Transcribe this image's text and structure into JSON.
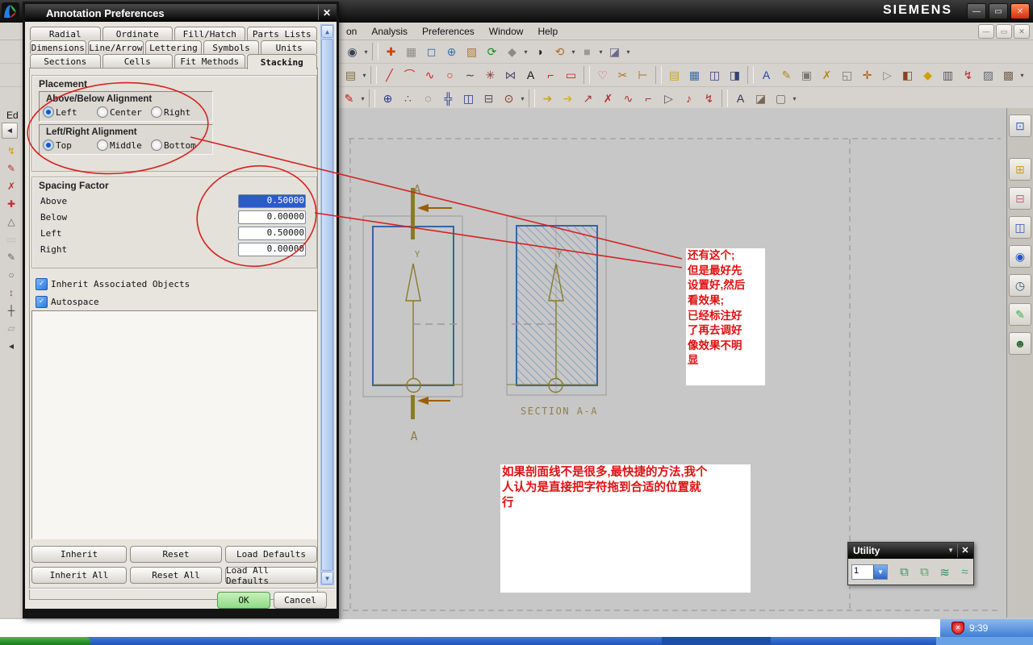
{
  "window": {
    "brand": "SIEMENS",
    "controls": {
      "minimize": "—",
      "restore": "▭",
      "close": "✕"
    }
  },
  "menu": {
    "items": [
      {
        "label": "on"
      },
      {
        "label": "Analysis"
      },
      {
        "label": "Preferences"
      },
      {
        "label": "Window"
      },
      {
        "label": "Help"
      }
    ]
  },
  "toolbars": {
    "row1": [
      {
        "n": "find",
        "g": "◉",
        "c": "#33424f",
        "d": true
      },
      {
        "n": "fit-view",
        "g": "✚",
        "c": "#cc4400",
        "s": true
      },
      {
        "n": "zoom-box",
        "g": "▦",
        "c": "#8a8a8a"
      },
      {
        "n": "zoom-region",
        "g": "◻",
        "c": "#3a6ea5"
      },
      {
        "n": "zoom-in-out",
        "g": "⊕",
        "c": "#3a6ea5"
      },
      {
        "n": "pan",
        "g": "▨",
        "c": "#b07c2a"
      },
      {
        "n": "refresh",
        "g": "⟳",
        "c": "#1f8a1f"
      },
      {
        "n": "shaded-view",
        "g": "◆",
        "c": "#8a8a8a",
        "d": true
      },
      {
        "n": "render-style",
        "g": "◑",
        "c": "#222"
      },
      {
        "n": "rotate-view",
        "g": "⟲",
        "c": "#b06a1a",
        "d": true
      },
      {
        "n": "display-mode",
        "g": "■",
        "c": "#9a9a9a",
        "d": true
      },
      {
        "n": "clip-section",
        "g": "◪",
        "c": "#6a6a8a",
        "d": true
      }
    ],
    "row2": [
      {
        "n": "note-style",
        "g": "▤",
        "c": "#7a6a3a",
        "d": true
      },
      {
        "n": "line",
        "g": "╱",
        "c": "#cc2222",
        "s": true
      },
      {
        "n": "arc",
        "g": "⌒",
        "c": "#cc2222"
      },
      {
        "n": "studio-spline",
        "g": "∿",
        "c": "#cc2222"
      },
      {
        "n": "circle",
        "g": "○",
        "c": "#cc2222"
      },
      {
        "n": "spline",
        "g": "∼",
        "c": "#444"
      },
      {
        "n": "point-curve",
        "g": "✳",
        "c": "#883333"
      },
      {
        "n": "mirror-curve",
        "g": "⋈",
        "c": "#555577"
      },
      {
        "n": "text",
        "g": "A",
        "c": "#111"
      },
      {
        "n": "corner",
        "g": "⌐",
        "c": "#cc2222"
      },
      {
        "n": "rectangle",
        "g": "▭",
        "c": "#cc2222"
      },
      {
        "n": "project-curve",
        "g": "♡",
        "c": "#cc5588",
        "s": true
      },
      {
        "n": "trim",
        "g": "✂",
        "c": "#b07020"
      },
      {
        "n": "extend",
        "g": "⊢",
        "c": "#b07020"
      },
      {
        "n": "notebooks",
        "g": "▤",
        "c": "#c9a227",
        "s": true
      },
      {
        "n": "image",
        "g": "▦",
        "c": "#3a6ea5"
      },
      {
        "n": "view-doc",
        "g": "◫",
        "c": "#334477"
      },
      {
        "n": "sheet-doc",
        "g": "◨",
        "c": "#334477"
      },
      {
        "n": "annotation-text",
        "g": "A",
        "c": "#2244aa",
        "s": true
      },
      {
        "n": "edit-text",
        "g": "✎",
        "c": "#b08a20"
      },
      {
        "n": "frame-select",
        "g": "▣",
        "c": "#777"
      },
      {
        "n": "wrench-note",
        "g": "✗",
        "c": "#b08a20"
      },
      {
        "n": "copy-view",
        "g": "◱",
        "c": "#777"
      },
      {
        "n": "datum-axis",
        "g": "✛",
        "c": "#aa5500"
      },
      {
        "n": "datum-plane",
        "g": "▷",
        "c": "#888"
      },
      {
        "n": "cube-view",
        "g": "◧",
        "c": "#884422"
      },
      {
        "n": "part-cube",
        "g": "◆",
        "c": "#d0a000"
      },
      {
        "n": "note-panel",
        "g": "▥",
        "c": "#556"
      },
      {
        "n": "move-note",
        "g": "↯",
        "c": "#a33"
      },
      {
        "n": "hatch-box",
        "g": "▨",
        "c": "#667"
      },
      {
        "n": "photo",
        "g": "▩",
        "c": "#765",
        "d": true
      }
    ],
    "row3": [
      {
        "n": "fill-style",
        "g": "✎",
        "c": "#cc1111",
        "d": true
      },
      {
        "n": "point",
        "g": "⊕",
        "c": "#223a8a",
        "s": true
      },
      {
        "n": "point-set",
        "g": "∴",
        "c": "#883355"
      },
      {
        "n": "reference-circle",
        "g": "◌",
        "c": "#445"
      },
      {
        "n": "crosshatch",
        "g": "╬",
        "c": "#223a8a"
      },
      {
        "n": "centerline-box",
        "g": "◫",
        "c": "#223a8a"
      },
      {
        "n": "centerline-2d",
        "g": "⊟",
        "c": "#556"
      },
      {
        "n": "target-point",
        "g": "⊙",
        "c": "#883322",
        "d": true
      },
      {
        "n": "key-note",
        "g": "➔",
        "c": "#c9a227",
        "s": true
      },
      {
        "n": "key-label",
        "g": "➔",
        "c": "#d4b030"
      },
      {
        "n": "leader",
        "g": "↗",
        "c": "#a33"
      },
      {
        "n": "cross-mark",
        "g": "✗",
        "c": "#a33"
      },
      {
        "n": "s-curve",
        "g": "∿",
        "c": "#a33"
      },
      {
        "n": "corner-note",
        "g": "⌐",
        "c": "#a33"
      },
      {
        "n": "flag-note",
        "g": "▷",
        "c": "#556"
      },
      {
        "n": "music-note",
        "g": "♪",
        "c": "#a33"
      },
      {
        "n": "lightning-note",
        "g": "↯",
        "c": "#a33"
      },
      {
        "n": "angular-note",
        "g": "A",
        "c": "#334",
        "s": true
      },
      {
        "n": "cube-note",
        "g": "◪",
        "c": "#765"
      },
      {
        "n": "monitor",
        "g": "▢",
        "c": "#667",
        "d": true
      }
    ]
  },
  "left_strip": {
    "label": "Ed",
    "collapse": "◄",
    "icons": [
      {
        "n": "lightning",
        "g": "↯",
        "c": "#c9a000"
      },
      {
        "n": "pencil-red",
        "g": "✎",
        "c": "#bb3333"
      },
      {
        "n": "cross-red",
        "g": "✗",
        "c": "#bb3333"
      },
      {
        "n": "plus-red",
        "g": "✚",
        "c": "#bb3333"
      },
      {
        "n": "triangle",
        "g": "△",
        "c": "#666"
      },
      {
        "n": "blank-box",
        "g": "▭",
        "c": "#bbb"
      },
      {
        "n": "pencil-grey",
        "g": "✎",
        "c": "#666"
      },
      {
        "n": "circle",
        "g": "○",
        "c": "#666"
      },
      {
        "n": "arrows",
        "g": "↕",
        "c": "#a33"
      },
      {
        "n": "cross-hair",
        "g": "┼",
        "c": "#333"
      },
      {
        "n": "parallelogram",
        "g": "▱",
        "c": "#999"
      },
      {
        "n": "collapse-arrow",
        "g": "◂",
        "c": "#333"
      }
    ]
  },
  "resource_bar": {
    "top_icon": {
      "n": "fit-window",
      "g": "⊡",
      "c": "#3366cc"
    },
    "icons": [
      {
        "n": "assembly-navigator",
        "g": "⊞",
        "c": "#c9a227"
      },
      {
        "n": "constraint-navigator",
        "g": "⊟",
        "c": "#cc6688"
      },
      {
        "n": "part-navigator",
        "g": "◫",
        "c": "#3355bb"
      },
      {
        "n": "reuse-library",
        "g": "◉",
        "c": "#2255cc"
      },
      {
        "n": "history",
        "g": "◷",
        "c": "#335577"
      },
      {
        "n": "visualization",
        "g": "✎",
        "c": "#33aa44"
      },
      {
        "n": "roles",
        "g": "☻",
        "c": "#336633"
      }
    ]
  },
  "dialog": {
    "title": "Annotation Preferences",
    "close_glyph": "✕",
    "tabs": {
      "row1": [
        "Radial",
        "Ordinate",
        "Fill/Hatch",
        "Parts Lists"
      ],
      "row2": [
        "Dimensions",
        "Line/Arrow",
        "Lettering",
        "Symbols",
        "Units"
      ],
      "row3": [
        "Sections",
        "Cells",
        "Fit Methods",
        "Stacking"
      ],
      "active": "Stacking"
    },
    "placement": {
      "header": "Placement",
      "above_below": {
        "header": "Above/Below Alignment",
        "options": [
          "Left",
          "Center",
          "Right"
        ],
        "selected": "Left"
      },
      "left_right": {
        "header": "Left/Right Alignment",
        "options": [
          "Top",
          "Middle",
          "Bottom"
        ],
        "selected": "Top"
      }
    },
    "spacing": {
      "header": "Spacing Factor",
      "rows": [
        {
          "label": "Above",
          "value": "0.50000",
          "selected": true
        },
        {
          "label": "Below",
          "value": "0.00000",
          "selected": false
        },
        {
          "label": "Left",
          "value": "0.50000",
          "selected": false
        },
        {
          "label": "Right",
          "value": "0.00000",
          "selected": false
        }
      ]
    },
    "checkboxes": [
      {
        "label": "Inherit Associated Objects",
        "checked": true
      },
      {
        "label": "Autospace",
        "checked": true
      }
    ],
    "buttons": {
      "row1": [
        "Inherit",
        "Reset",
        "Load Defaults"
      ],
      "row2": [
        "Inherit All",
        "Reset All",
        "Load All Defaults"
      ],
      "ok": "OK",
      "cancel": "Cancel"
    }
  },
  "drawing": {
    "labels": {
      "section_top": "A",
      "section_bottom": "A",
      "axis_left": "Y",
      "axis_right": "Y",
      "section_title": "SECTION A-A"
    },
    "colors": {
      "part_outline": "#3465a4",
      "centerline": "#8a7a2a",
      "arrow": "#9c5f00",
      "cad_text": "#8f7f4f"
    }
  },
  "annotations": {
    "color": "#dd1111",
    "note_right": "还有这个;\n但是最好先\n设置好,然后\n看效果;\n已经标注好\n了再去调好\n像效果不明\n显",
    "note_bottom": "如果剖面线不是很多,最快捷的方法,我个\n人认为是直接把字符拖到合适的位置就\n行"
  },
  "utility": {
    "title": "Utility",
    "close_glyph": "✕",
    "dropdown_value": "1",
    "icons": [
      {
        "n": "layer-settings",
        "g": "⧉",
        "c": "#3f8f5f"
      },
      {
        "n": "layer-visible-in-view",
        "g": "⧉",
        "c": "#5a9f6f"
      },
      {
        "n": "move-to-layer",
        "g": "≋",
        "c": "#3f8f5f"
      },
      {
        "n": "copy-to-layer",
        "g": "≈",
        "c": "#5a9f6f"
      }
    ]
  },
  "taskbar": {
    "time": "9:39"
  }
}
